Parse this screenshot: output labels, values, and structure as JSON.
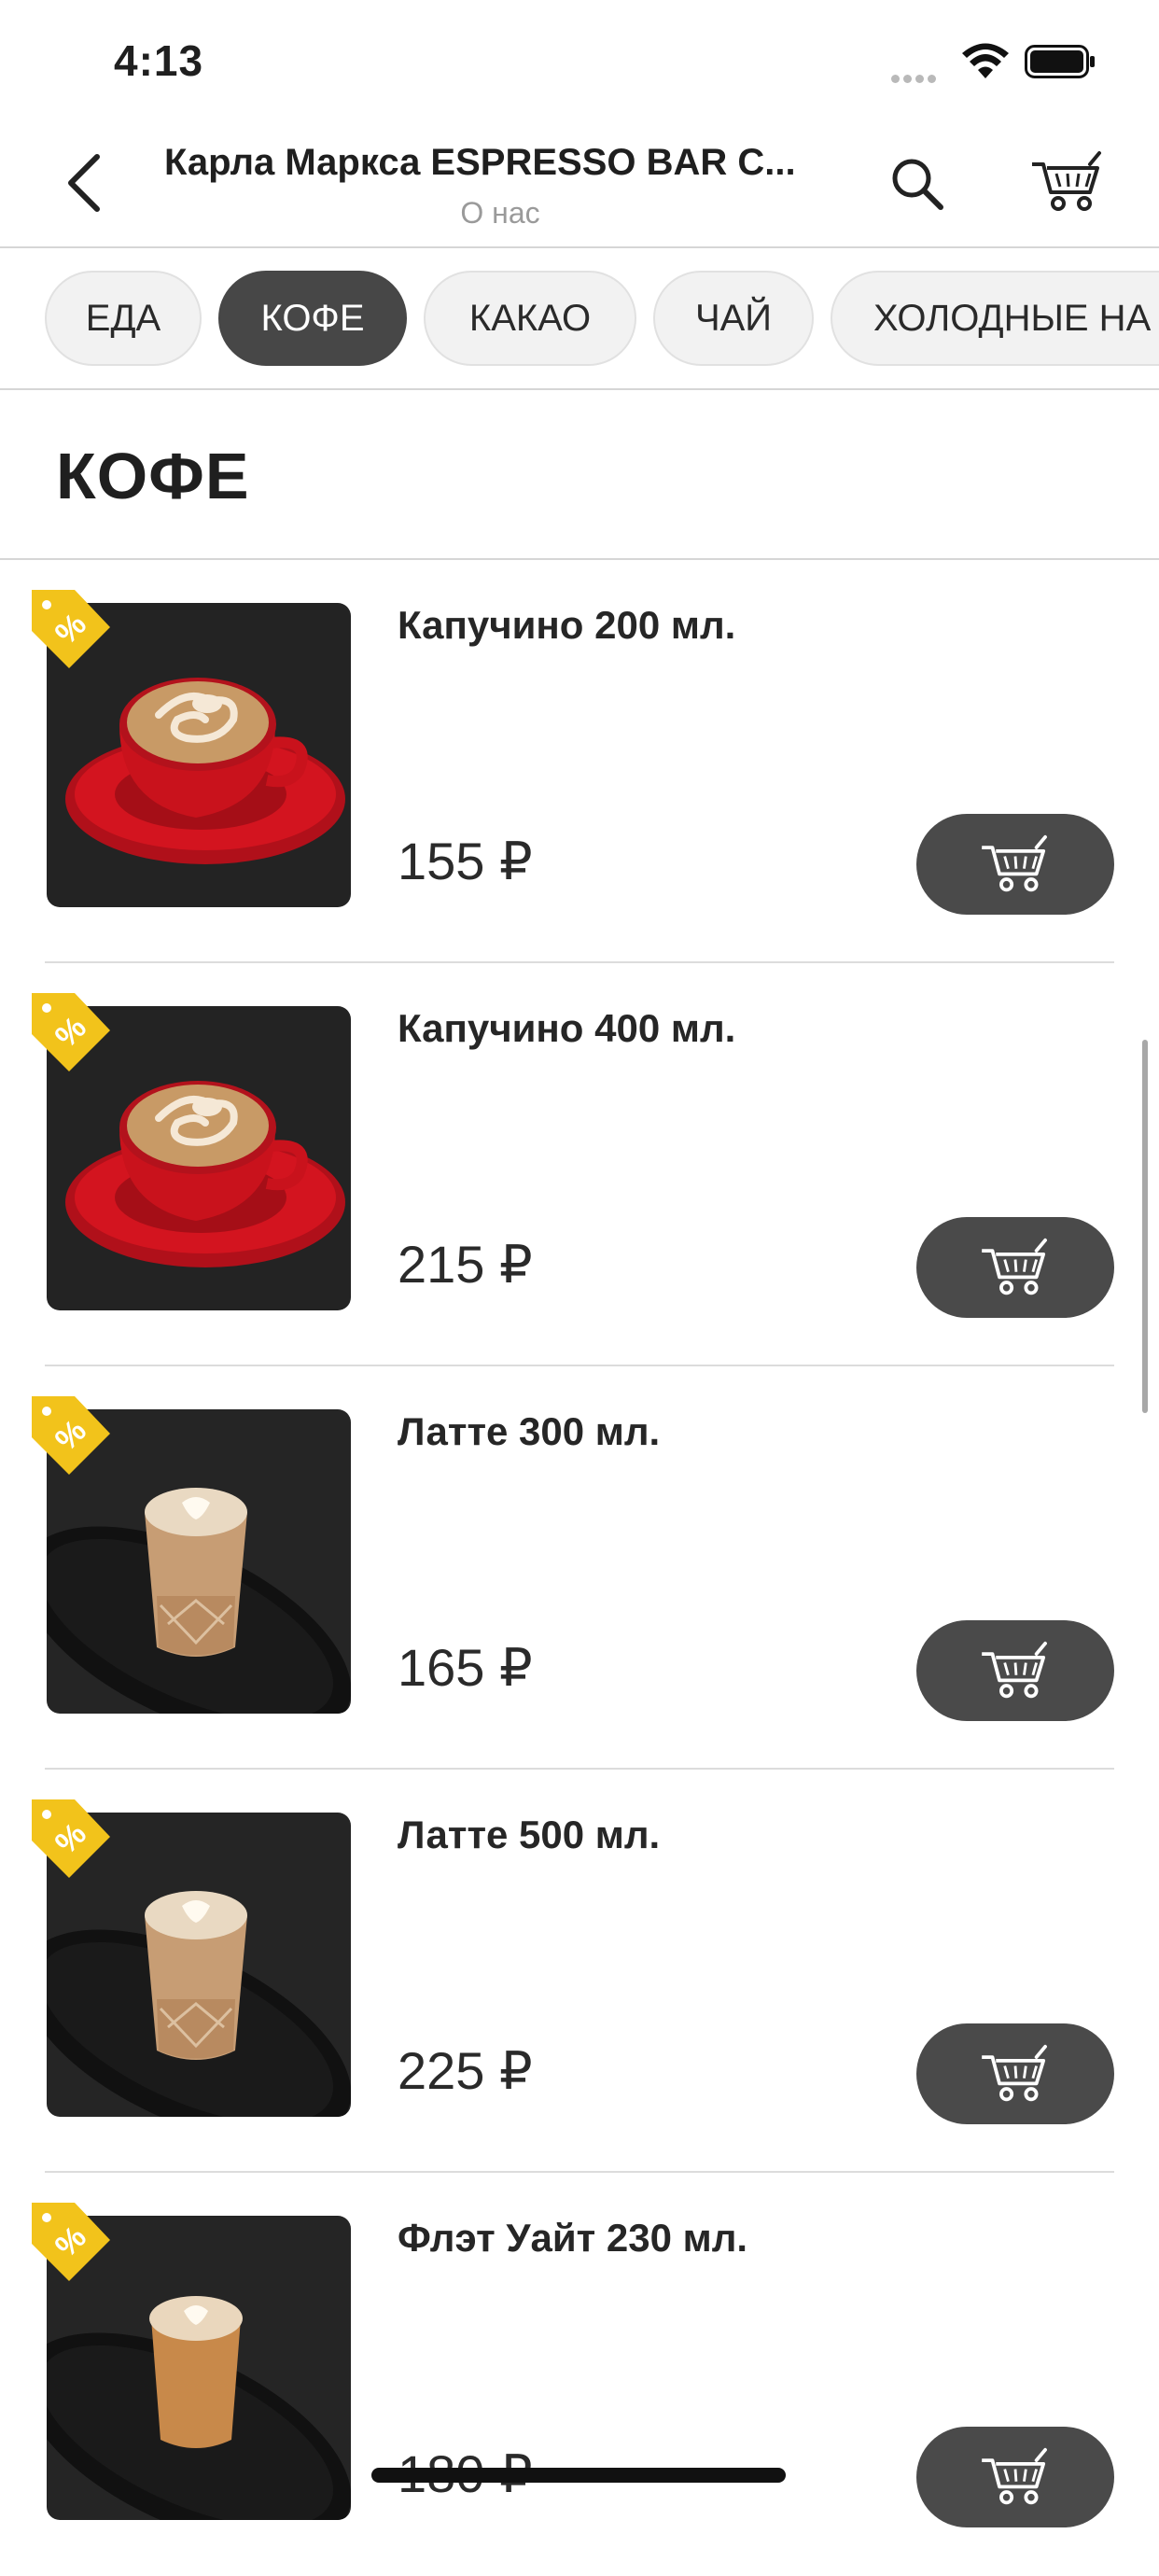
{
  "status_bar": {
    "time": "4:13"
  },
  "header": {
    "title": "Карла Маркса ESPRESSO BAR C...",
    "subtitle": "О нас"
  },
  "tabs": [
    {
      "label": "ЕДА",
      "active": false
    },
    {
      "label": "КОФЕ",
      "active": true
    },
    {
      "label": "КАКАО",
      "active": false
    },
    {
      "label": "ЧАЙ",
      "active": false
    },
    {
      "label": "ХОЛОДНЫЕ НА",
      "active": false
    }
  ],
  "section": {
    "title": "КОФЕ"
  },
  "items": [
    {
      "name": "Капучино 200 мл.",
      "price": "155 ₽",
      "image": "red-cup-cappuccino"
    },
    {
      "name": "Капучино 400 мл.",
      "price": "215 ₽",
      "image": "red-cup-cappuccino"
    },
    {
      "name": "Латте 300 мл.",
      "price": "165 ₽",
      "image": "glass-latte-on-tray"
    },
    {
      "name": "Латте 500 мл.",
      "price": "225 ₽",
      "image": "glass-latte-on-tray"
    },
    {
      "name": "Флэт Уайт 230 мл.",
      "price": "180 ₽",
      "image": "glass-flat-white-on-tray"
    }
  ],
  "icons": {
    "back": "chevron-left-icon",
    "search": "search-icon",
    "cart": "cart-icon",
    "discount": "discount-tag-icon"
  },
  "colors": {
    "active_tab": "#474747",
    "add_button": "#4a4a4a",
    "discount_tag": "#f2c31b"
  }
}
